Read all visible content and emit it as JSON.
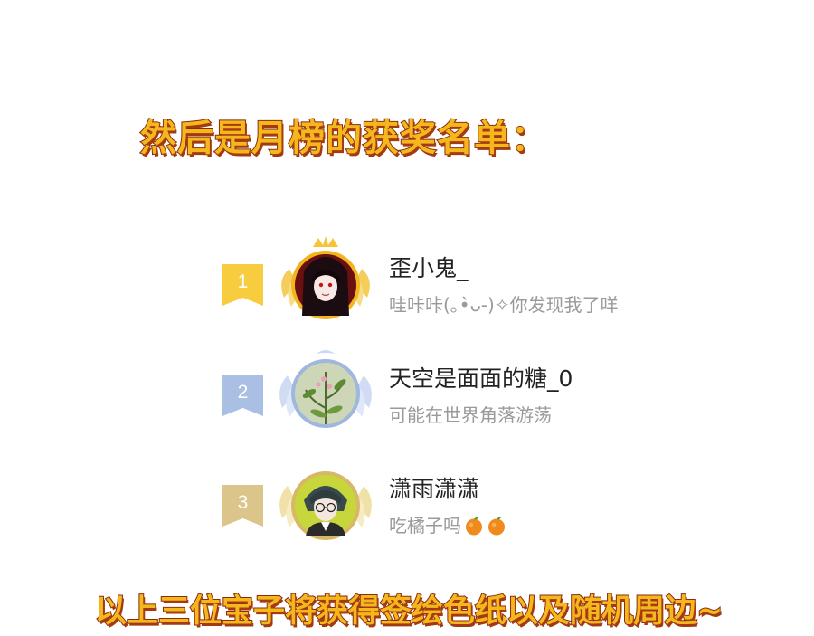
{
  "headline": "然后是月榜的获奖名单：",
  "footer": "以上三位宝子将获得签绘色纸以及随机周边~",
  "ranking": [
    {
      "rank": "1",
      "name": "歪小鬼_",
      "status": "哇咔咔(｡•̀ᴗ-)✧你发现我了咩",
      "ribbon_color": "#f7cd3f",
      "frame": "gold-crown"
    },
    {
      "rank": "2",
      "name": "天空是面面的糖_0",
      "status": "可能在世界角落游荡",
      "ribbon_color": "#a9bfe3",
      "frame": "silver-wings"
    },
    {
      "rank": "3",
      "name": "潇雨潇潇",
      "status": "吃橘子吗",
      "status_emoji": [
        "orange-emoji-icon",
        "orange-emoji-icon"
      ],
      "ribbon_color": "#dcc58a",
      "frame": "bronze-wings"
    }
  ],
  "colors": {
    "title_fill": "#f5b81c",
    "title_outline": "#8a2a10",
    "name_text": "#222222",
    "status_text": "#9a9a9a"
  }
}
